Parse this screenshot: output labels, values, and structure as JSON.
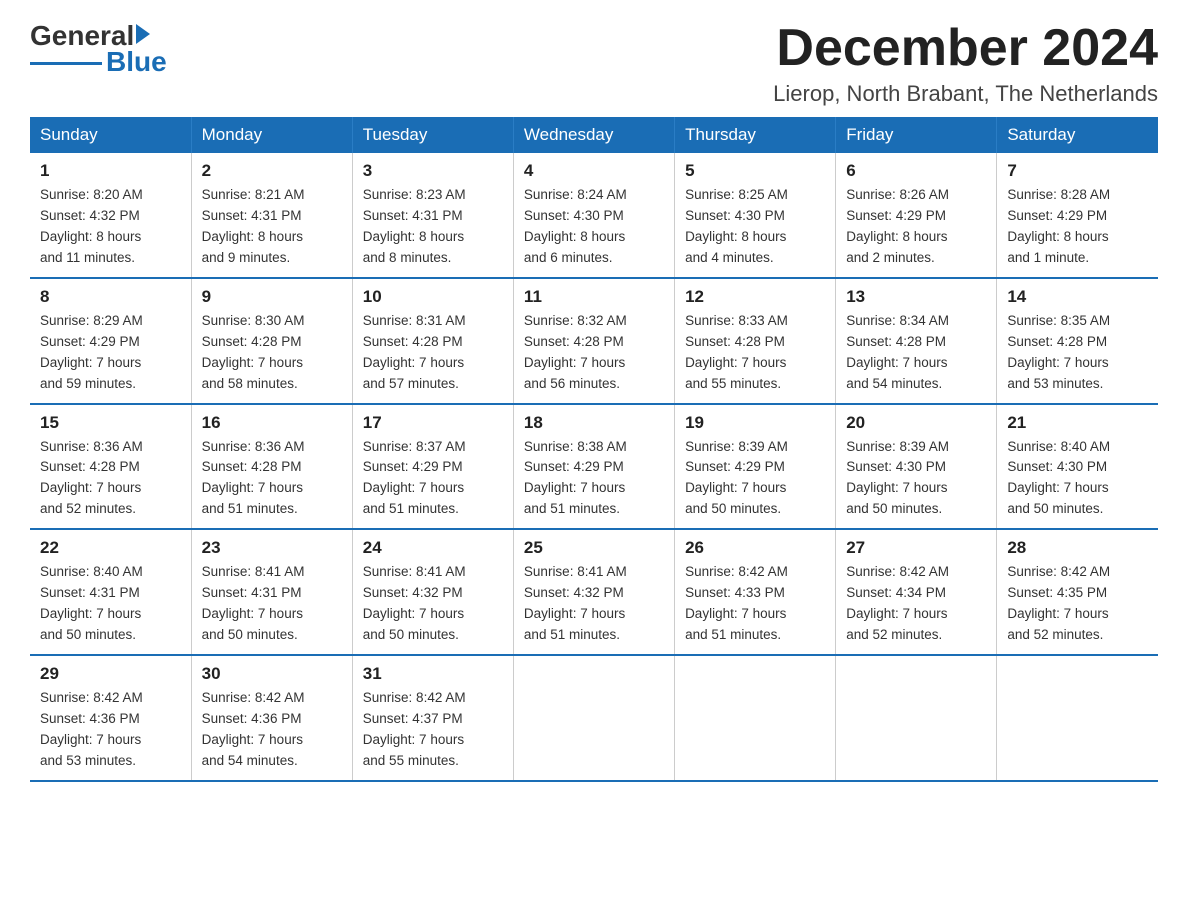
{
  "header": {
    "logo_general": "General",
    "logo_blue": "Blue",
    "month_year": "December 2024",
    "location": "Lierop, North Brabant, The Netherlands"
  },
  "days_of_week": [
    "Sunday",
    "Monday",
    "Tuesday",
    "Wednesday",
    "Thursday",
    "Friday",
    "Saturday"
  ],
  "weeks": [
    [
      {
        "day": "1",
        "sunrise": "8:20 AM",
        "sunset": "4:32 PM",
        "daylight": "8 hours and 11 minutes."
      },
      {
        "day": "2",
        "sunrise": "8:21 AM",
        "sunset": "4:31 PM",
        "daylight": "8 hours and 9 minutes."
      },
      {
        "day": "3",
        "sunrise": "8:23 AM",
        "sunset": "4:31 PM",
        "daylight": "8 hours and 8 minutes."
      },
      {
        "day": "4",
        "sunrise": "8:24 AM",
        "sunset": "4:30 PM",
        "daylight": "8 hours and 6 minutes."
      },
      {
        "day": "5",
        "sunrise": "8:25 AM",
        "sunset": "4:30 PM",
        "daylight": "8 hours and 4 minutes."
      },
      {
        "day": "6",
        "sunrise": "8:26 AM",
        "sunset": "4:29 PM",
        "daylight": "8 hours and 2 minutes."
      },
      {
        "day": "7",
        "sunrise": "8:28 AM",
        "sunset": "4:29 PM",
        "daylight": "8 hours and 1 minute."
      }
    ],
    [
      {
        "day": "8",
        "sunrise": "8:29 AM",
        "sunset": "4:29 PM",
        "daylight": "7 hours and 59 minutes."
      },
      {
        "day": "9",
        "sunrise": "8:30 AM",
        "sunset": "4:28 PM",
        "daylight": "7 hours and 58 minutes."
      },
      {
        "day": "10",
        "sunrise": "8:31 AM",
        "sunset": "4:28 PM",
        "daylight": "7 hours and 57 minutes."
      },
      {
        "day": "11",
        "sunrise": "8:32 AM",
        "sunset": "4:28 PM",
        "daylight": "7 hours and 56 minutes."
      },
      {
        "day": "12",
        "sunrise": "8:33 AM",
        "sunset": "4:28 PM",
        "daylight": "7 hours and 55 minutes."
      },
      {
        "day": "13",
        "sunrise": "8:34 AM",
        "sunset": "4:28 PM",
        "daylight": "7 hours and 54 minutes."
      },
      {
        "day": "14",
        "sunrise": "8:35 AM",
        "sunset": "4:28 PM",
        "daylight": "7 hours and 53 minutes."
      }
    ],
    [
      {
        "day": "15",
        "sunrise": "8:36 AM",
        "sunset": "4:28 PM",
        "daylight": "7 hours and 52 minutes."
      },
      {
        "day": "16",
        "sunrise": "8:36 AM",
        "sunset": "4:28 PM",
        "daylight": "7 hours and 51 minutes."
      },
      {
        "day": "17",
        "sunrise": "8:37 AM",
        "sunset": "4:29 PM",
        "daylight": "7 hours and 51 minutes."
      },
      {
        "day": "18",
        "sunrise": "8:38 AM",
        "sunset": "4:29 PM",
        "daylight": "7 hours and 51 minutes."
      },
      {
        "day": "19",
        "sunrise": "8:39 AM",
        "sunset": "4:29 PM",
        "daylight": "7 hours and 50 minutes."
      },
      {
        "day": "20",
        "sunrise": "8:39 AM",
        "sunset": "4:30 PM",
        "daylight": "7 hours and 50 minutes."
      },
      {
        "day": "21",
        "sunrise": "8:40 AM",
        "sunset": "4:30 PM",
        "daylight": "7 hours and 50 minutes."
      }
    ],
    [
      {
        "day": "22",
        "sunrise": "8:40 AM",
        "sunset": "4:31 PM",
        "daylight": "7 hours and 50 minutes."
      },
      {
        "day": "23",
        "sunrise": "8:41 AM",
        "sunset": "4:31 PM",
        "daylight": "7 hours and 50 minutes."
      },
      {
        "day": "24",
        "sunrise": "8:41 AM",
        "sunset": "4:32 PM",
        "daylight": "7 hours and 50 minutes."
      },
      {
        "day": "25",
        "sunrise": "8:41 AM",
        "sunset": "4:32 PM",
        "daylight": "7 hours and 51 minutes."
      },
      {
        "day": "26",
        "sunrise": "8:42 AM",
        "sunset": "4:33 PM",
        "daylight": "7 hours and 51 minutes."
      },
      {
        "day": "27",
        "sunrise": "8:42 AM",
        "sunset": "4:34 PM",
        "daylight": "7 hours and 52 minutes."
      },
      {
        "day": "28",
        "sunrise": "8:42 AM",
        "sunset": "4:35 PM",
        "daylight": "7 hours and 52 minutes."
      }
    ],
    [
      {
        "day": "29",
        "sunrise": "8:42 AM",
        "sunset": "4:36 PM",
        "daylight": "7 hours and 53 minutes."
      },
      {
        "day": "30",
        "sunrise": "8:42 AM",
        "sunset": "4:36 PM",
        "daylight": "7 hours and 54 minutes."
      },
      {
        "day": "31",
        "sunrise": "8:42 AM",
        "sunset": "4:37 PM",
        "daylight": "7 hours and 55 minutes."
      },
      null,
      null,
      null,
      null
    ]
  ],
  "labels": {
    "sunrise": "Sunrise:",
    "sunset": "Sunset:",
    "daylight": "Daylight:"
  }
}
